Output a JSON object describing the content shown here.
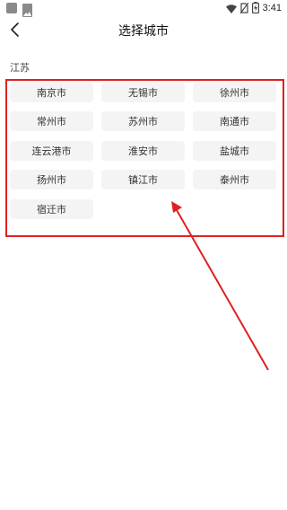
{
  "status_bar": {
    "time": "3:41"
  },
  "header": {
    "title": "选择城市"
  },
  "province": {
    "name": "江苏"
  },
  "cities": [
    "南京市",
    "无锡市",
    "徐州市",
    "常州市",
    "苏州市",
    "南通市",
    "连云港市",
    "淮安市",
    "盐城市",
    "扬州市",
    "镇江市",
    "泰州市",
    "宿迁市"
  ],
  "colors": {
    "annotation": "#e02020",
    "button_bg": "#f4f4f4"
  },
  "icons": [
    "back-arrow-icon",
    "wifi-icon",
    "no-sim-icon",
    "battery-charging-icon"
  ]
}
